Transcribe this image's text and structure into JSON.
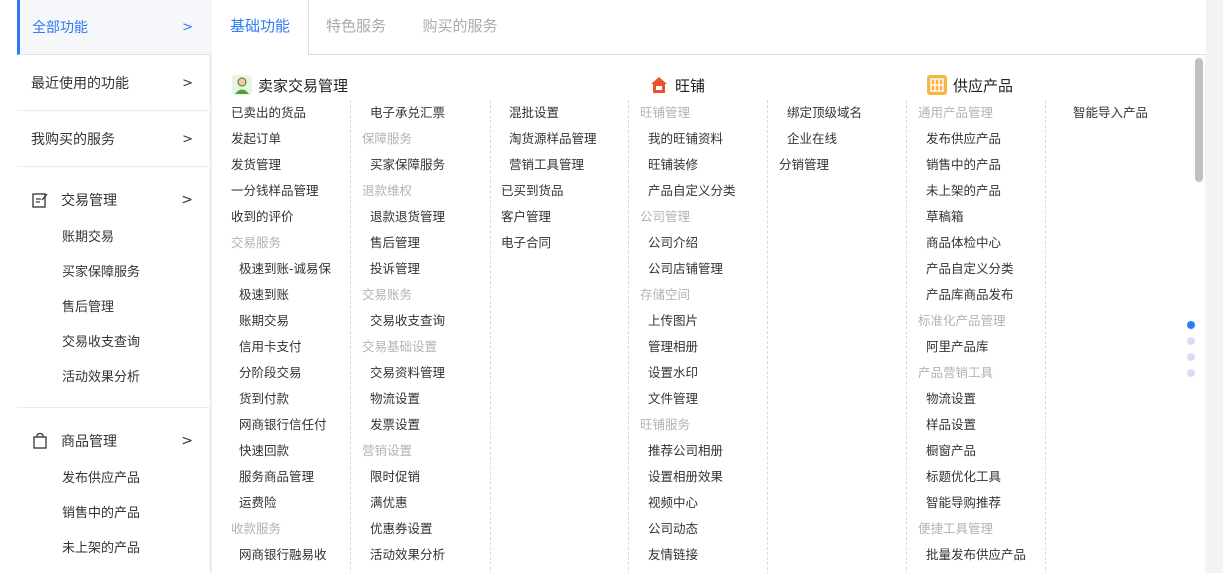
{
  "sidebar": {
    "all_functions": "全部功能",
    "recent": "最近使用的功能",
    "purchased": "我购买的服务",
    "arrow": ">",
    "groups": [
      {
        "label": "交易管理",
        "items": [
          "账期交易",
          "买家保障服务",
          "售后管理",
          "交易收支查询",
          "活动效果分析"
        ]
      },
      {
        "label": "商品管理",
        "items": [
          "发布供应产品",
          "销售中的产品",
          "未上架的产品"
        ]
      }
    ]
  },
  "tabs": [
    "基础功能",
    "特色服务",
    "购买的服务"
  ],
  "sections": {
    "seller": "卖家交易管理",
    "shop": "旺铺",
    "supply": "供应产品"
  },
  "columns": {
    "c1": [
      {
        "t": "已卖出的货品",
        "k": "item"
      },
      {
        "t": "发起订单",
        "k": "item"
      },
      {
        "t": "发货管理",
        "k": "item"
      },
      {
        "t": "一分钱样品管理",
        "k": "item"
      },
      {
        "t": "收到的评价",
        "k": "item"
      },
      {
        "t": "交易服务",
        "k": "hdr"
      },
      {
        "t": "极速到账-诚易保",
        "k": "ind"
      },
      {
        "t": "极速到账",
        "k": "ind"
      },
      {
        "t": "账期交易",
        "k": "ind"
      },
      {
        "t": "信用卡支付",
        "k": "ind"
      },
      {
        "t": "分阶段交易",
        "k": "ind"
      },
      {
        "t": "货到付款",
        "k": "ind"
      },
      {
        "t": "网商银行信任付",
        "k": "ind"
      },
      {
        "t": "快速回款",
        "k": "ind"
      },
      {
        "t": "服务商品管理",
        "k": "ind"
      },
      {
        "t": "运费险",
        "k": "ind"
      },
      {
        "t": "收款服务",
        "k": "hdr"
      },
      {
        "t": "网商银行融易收",
        "k": "ind"
      }
    ],
    "c2": [
      {
        "t": "电子承兑汇票",
        "k": "ind"
      },
      {
        "t": "保障服务",
        "k": "hdr"
      },
      {
        "t": "买家保障服务",
        "k": "ind"
      },
      {
        "t": "退款维权",
        "k": "hdr"
      },
      {
        "t": "退款退货管理",
        "k": "ind"
      },
      {
        "t": "售后管理",
        "k": "ind"
      },
      {
        "t": "投诉管理",
        "k": "ind"
      },
      {
        "t": "交易账务",
        "k": "hdr"
      },
      {
        "t": "交易收支查询",
        "k": "ind"
      },
      {
        "t": "交易基础设置",
        "k": "hdr"
      },
      {
        "t": "交易资料管理",
        "k": "ind"
      },
      {
        "t": "物流设置",
        "k": "ind"
      },
      {
        "t": "发票设置",
        "k": "ind"
      },
      {
        "t": "营销设置",
        "k": "hdr"
      },
      {
        "t": "限时促销",
        "k": "ind"
      },
      {
        "t": "满优惠",
        "k": "ind"
      },
      {
        "t": "优惠券设置",
        "k": "ind"
      },
      {
        "t": "活动效果分析",
        "k": "ind"
      }
    ],
    "c3": [
      {
        "t": "混批设置",
        "k": "ind"
      },
      {
        "t": "淘货源样品管理",
        "k": "ind"
      },
      {
        "t": "营销工具管理",
        "k": "ind"
      },
      {
        "t": "已买到货品",
        "k": "item"
      },
      {
        "t": "客户管理",
        "k": "item"
      },
      {
        "t": "电子合同",
        "k": "item"
      }
    ],
    "c4": [
      {
        "t": "旺铺管理",
        "k": "hdr"
      },
      {
        "t": "我的旺铺资料",
        "k": "ind"
      },
      {
        "t": "旺铺装修",
        "k": "ind"
      },
      {
        "t": "产品自定义分类",
        "k": "ind"
      },
      {
        "t": "公司管理",
        "k": "hdr"
      },
      {
        "t": "公司介绍",
        "k": "ind"
      },
      {
        "t": "公司店铺管理",
        "k": "ind"
      },
      {
        "t": "存储空间",
        "k": "hdr"
      },
      {
        "t": "上传图片",
        "k": "ind"
      },
      {
        "t": "管理相册",
        "k": "ind"
      },
      {
        "t": "设置水印",
        "k": "ind"
      },
      {
        "t": "文件管理",
        "k": "ind"
      },
      {
        "t": "旺铺服务",
        "k": "hdr"
      },
      {
        "t": "推荐公司相册",
        "k": "ind"
      },
      {
        "t": "设置相册效果",
        "k": "ind"
      },
      {
        "t": "视频中心",
        "k": "ind"
      },
      {
        "t": "公司动态",
        "k": "ind"
      },
      {
        "t": "友情链接",
        "k": "ind"
      }
    ],
    "c5": [
      {
        "t": "绑定顶级域名",
        "k": "ind"
      },
      {
        "t": "企业在线",
        "k": "ind"
      },
      {
        "t": "分销管理",
        "k": "item"
      }
    ],
    "c6": [
      {
        "t": "通用产品管理",
        "k": "hdr"
      },
      {
        "t": "发布供应产品",
        "k": "ind"
      },
      {
        "t": "销售中的产品",
        "k": "ind"
      },
      {
        "t": "未上架的产品",
        "k": "ind"
      },
      {
        "t": "草稿箱",
        "k": "ind"
      },
      {
        "t": "商品体检中心",
        "k": "ind"
      },
      {
        "t": "产品自定义分类",
        "k": "ind"
      },
      {
        "t": "产品库商品发布",
        "k": "ind"
      },
      {
        "t": "标准化产品管理",
        "k": "hdr"
      },
      {
        "t": "阿里产品库",
        "k": "ind"
      },
      {
        "t": "产品营销工具",
        "k": "hdr"
      },
      {
        "t": "物流设置",
        "k": "ind"
      },
      {
        "t": "样品设置",
        "k": "ind"
      },
      {
        "t": "橱窗产品",
        "k": "ind"
      },
      {
        "t": "标题优化工具",
        "k": "ind"
      },
      {
        "t": "智能导购推荐",
        "k": "ind"
      },
      {
        "t": "便捷工具管理",
        "k": "hdr"
      },
      {
        "t": "批量发布供应产品",
        "k": "ind"
      }
    ],
    "c7": [
      {
        "t": "智能导入产品",
        "k": "ind"
      }
    ]
  },
  "colors": {
    "accent": "#2f7bf3",
    "header_gray": "#b3b3b3"
  }
}
